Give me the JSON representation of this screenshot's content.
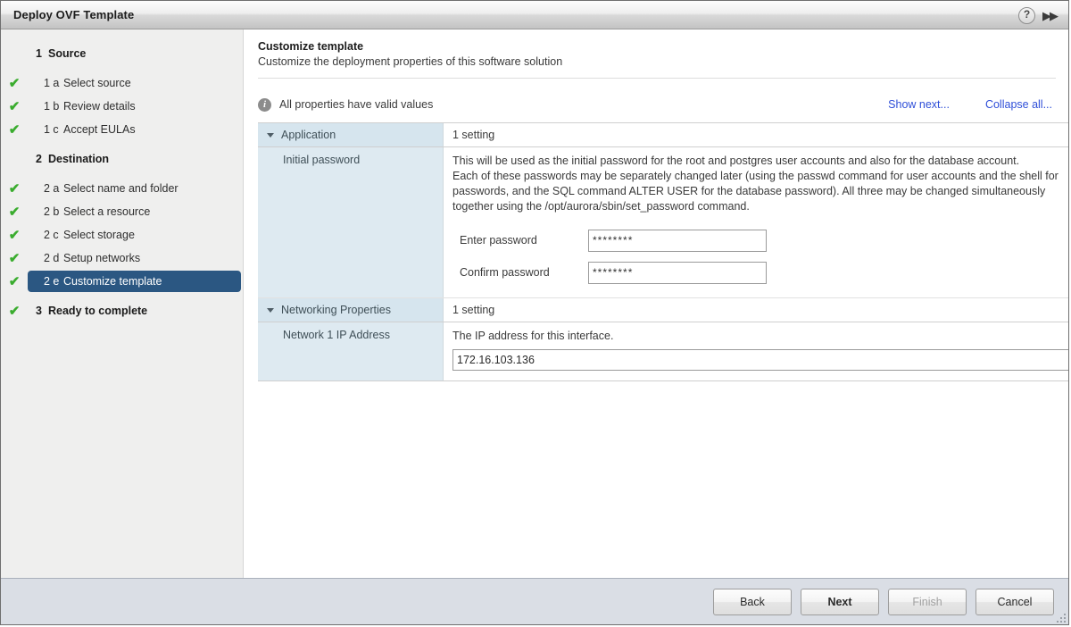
{
  "window": {
    "title": "Deploy OVF Template",
    "help_icon": "?",
    "expand_icon": "▶▶"
  },
  "sidebar": {
    "items": [
      {
        "num": "1",
        "label": "Source",
        "level": "group",
        "checked": false,
        "selected": false
      },
      {
        "num": "1 a",
        "label": "Select source",
        "level": "sub",
        "checked": true,
        "selected": false
      },
      {
        "num": "1 b",
        "label": "Review details",
        "level": "sub",
        "checked": true,
        "selected": false
      },
      {
        "num": "1 c",
        "label": "Accept EULAs",
        "level": "sub",
        "checked": true,
        "selected": false
      },
      {
        "num": "2",
        "label": "Destination",
        "level": "group",
        "checked": false,
        "selected": false
      },
      {
        "num": "2 a",
        "label": "Select name and folder",
        "level": "sub",
        "checked": true,
        "selected": false
      },
      {
        "num": "2 b",
        "label": "Select a resource",
        "level": "sub",
        "checked": true,
        "selected": false
      },
      {
        "num": "2 c",
        "label": "Select storage",
        "level": "sub",
        "checked": true,
        "selected": false
      },
      {
        "num": "2 d",
        "label": "Setup networks",
        "level": "sub",
        "checked": true,
        "selected": false
      },
      {
        "num": "2 e",
        "label": "Customize template",
        "level": "sub",
        "checked": true,
        "selected": true
      },
      {
        "num": "3",
        "label": "Ready to complete",
        "level": "group",
        "checked": true,
        "selected": false
      }
    ]
  },
  "main": {
    "title": "Customize template",
    "subtitle": "Customize the deployment properties of this software solution",
    "status_text": "All properties have valid values",
    "link_show_next": "Show next...",
    "link_collapse_all": "Collapse all...",
    "groups": [
      {
        "name": "Application",
        "setting_count": "1 setting",
        "property_label": "Initial password",
        "description_lines": [
          "This will be used as the initial password for the root and postgres user accounts and also for the database account.",
          "Each of these passwords may be separately changed later (using the passwd command for user accounts and the shell for",
          "passwords, and the SQL command ALTER USER for the database password). All three may be changed simultaneously",
          "together using the /opt/aurora/sbin/set_password command."
        ],
        "fields": [
          {
            "label": "Enter password",
            "value": "********"
          },
          {
            "label": "Confirm password",
            "value": "********"
          }
        ]
      },
      {
        "name": "Networking Properties",
        "setting_count": "1 setting",
        "property_label": "Network 1 IP Address",
        "description": "The IP address for this interface.",
        "value": "172.16.103.136"
      }
    ]
  },
  "footer": {
    "back": "Back",
    "next": "Next",
    "finish": "Finish",
    "cancel": "Cancel"
  },
  "colors": {
    "accent_selected": "#2b5782",
    "check_green": "#3aac2e",
    "link_blue": "#2f4fd8",
    "prop_left_bg": "#deeaf1",
    "footer_bg": "#dadee5"
  }
}
